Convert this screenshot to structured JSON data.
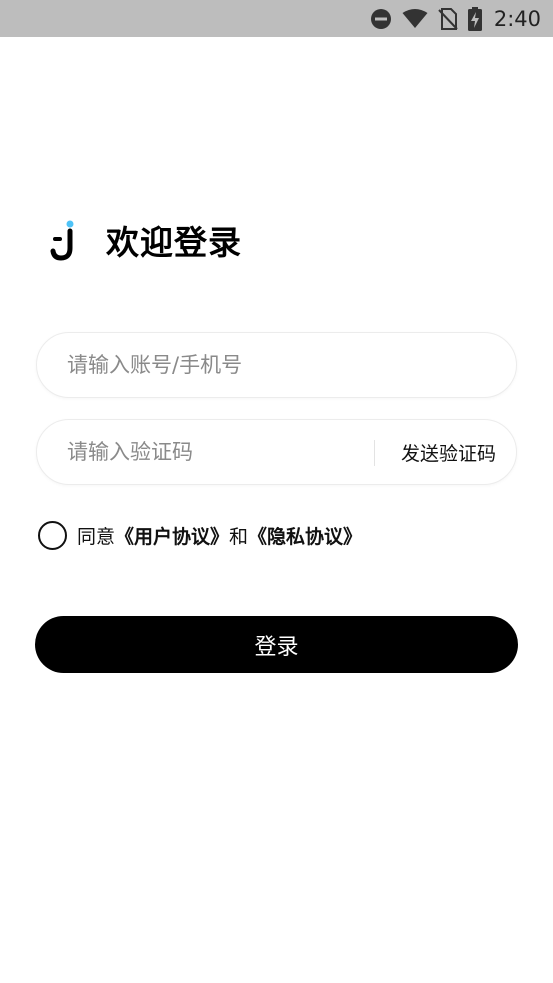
{
  "status_bar": {
    "time": "2:40",
    "icons": [
      "dnd-icon",
      "wifi-icon",
      "no-sim-icon",
      "battery-charging-icon"
    ]
  },
  "header": {
    "logo_icon": "j-logo-icon",
    "title": "欢迎登录"
  },
  "form": {
    "account_placeholder": "请输入账号/手机号",
    "code_placeholder": "请输入验证码",
    "send_code_label": "发送验证码"
  },
  "agreement": {
    "prefix": "同意",
    "user_agreement": "《用户协议》",
    "and": "和",
    "privacy_agreement": "《隐私协议》"
  },
  "login_button": {
    "label": "登录"
  },
  "colors": {
    "accent": "#000000",
    "status_bar_bg": "#bdbdbd",
    "logo_dot": "#4fc3f7"
  }
}
